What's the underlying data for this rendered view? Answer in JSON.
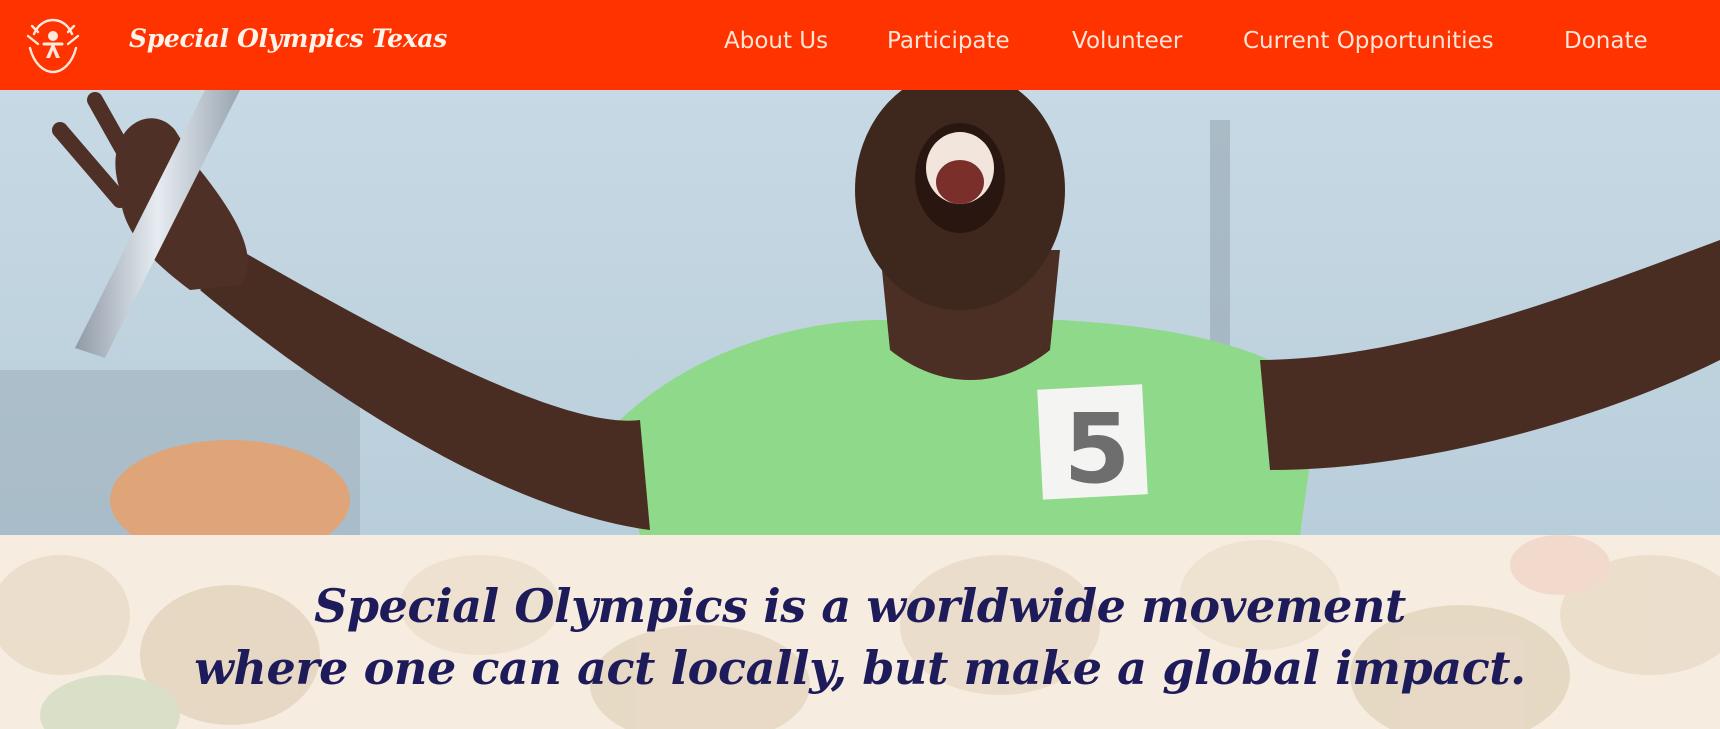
{
  "header": {
    "brand_name": "Special Olympics Texas",
    "logo_icon": "special-olympics-figure-icon",
    "nav": [
      {
        "label": "About Us"
      },
      {
        "label": "Participate"
      },
      {
        "label": "Volunteer"
      },
      {
        "label": "Current Opportunities"
      },
      {
        "label": "Donate"
      }
    ],
    "colors": {
      "background": "#ff3300",
      "text": "#fde5d8"
    }
  },
  "hero": {
    "bib_number": "5"
  },
  "mission": {
    "line1": "Special Olympics is a worldwide movement",
    "line2": "where one can act locally, but make a global impact.",
    "colors": {
      "text": "#1e1b5a",
      "background": "#f6ece0"
    }
  }
}
